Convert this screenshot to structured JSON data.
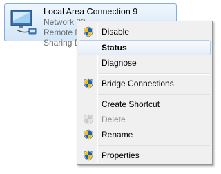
{
  "connection": {
    "name": "Local Area Connection 9",
    "network": "Network 83",
    "device": "Remote NDIS based Internet Sharing Device",
    "icon": "network-adapter-icon"
  },
  "context_menu": {
    "items": [
      {
        "label": "Disable",
        "icon": "uac-shield-icon"
      },
      {
        "label": "Status",
        "state": "highlighted"
      },
      {
        "label": "Diagnose"
      },
      {
        "label": "Bridge Connections",
        "icon": "uac-shield-icon"
      },
      {
        "label": "Create Shortcut"
      },
      {
        "label": "Delete",
        "icon": "uac-shield-icon",
        "state": "disabled"
      },
      {
        "label": "Rename",
        "icon": "uac-shield-icon"
      },
      {
        "label": "Properties",
        "icon": "uac-shield-icon"
      }
    ]
  },
  "colors": {
    "selection_fill": "#d3e6f8",
    "selection_border": "#84acdd",
    "menu_background": "#f0f0f0",
    "highlight_border": "#aecff7",
    "shield_blue": "#1e5fb8",
    "shield_yellow": "#f3c300"
  }
}
